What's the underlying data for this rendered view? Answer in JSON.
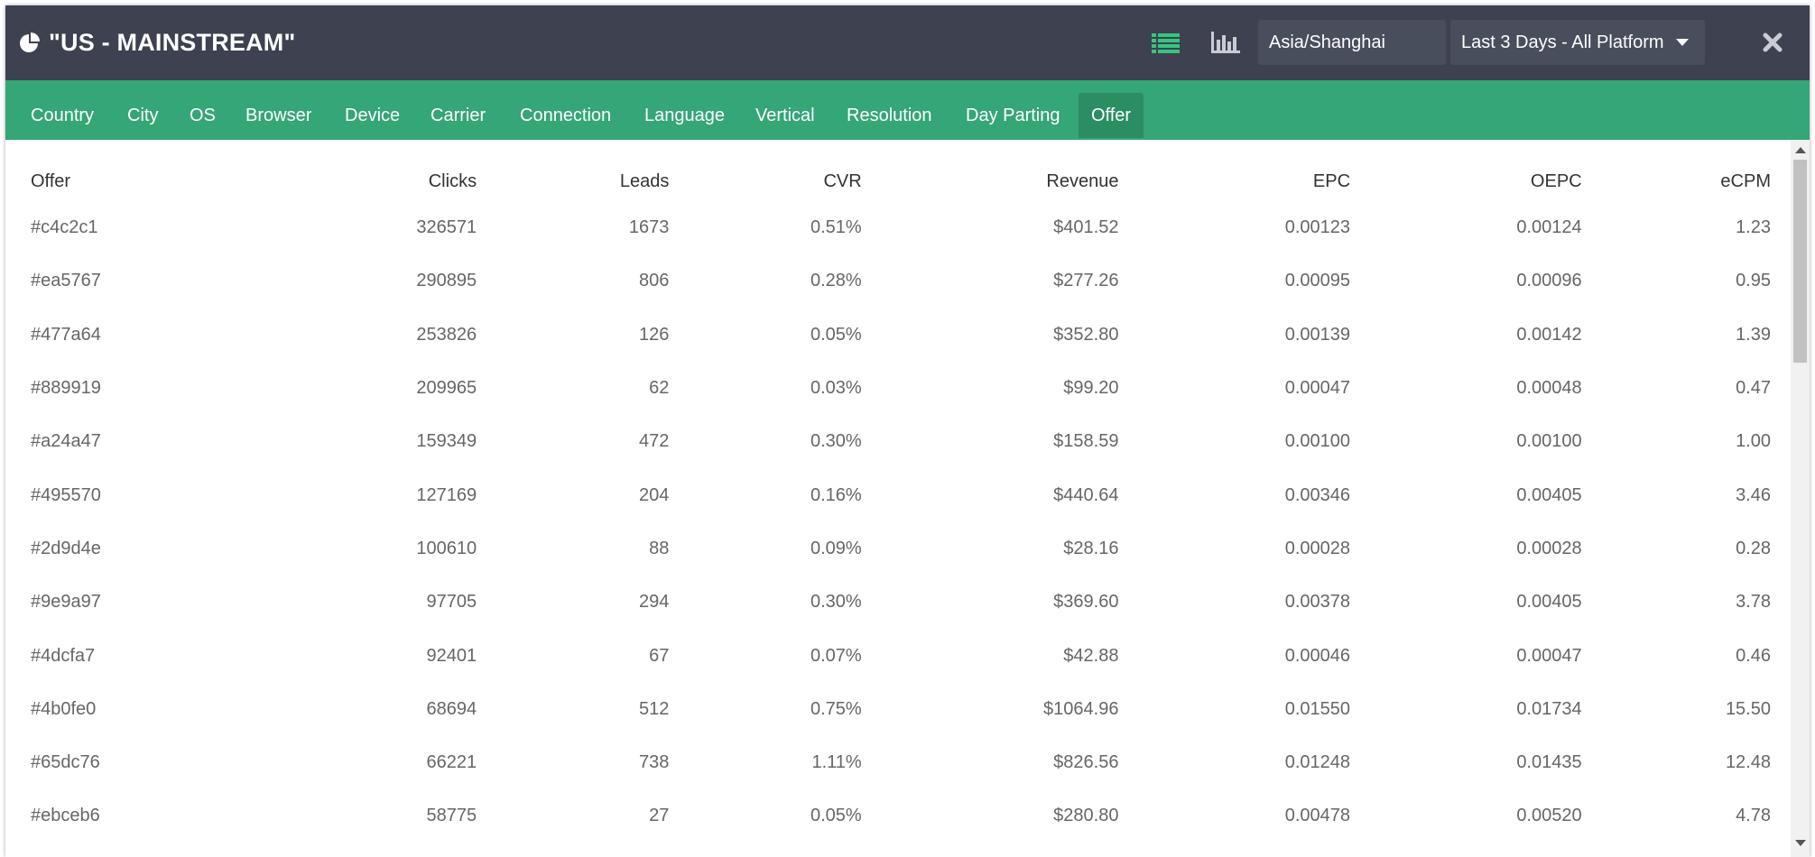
{
  "header": {
    "title": "\"US - MAINSTREAM\"",
    "title_icon": "pie-chart-icon",
    "table_view_icon": "list-icon",
    "chart_view_icon": "bar-chart-icon",
    "timezone_value": "Asia/Shanghai",
    "range_value": "Last 3 Days - All Platform",
    "close_icon": "close-icon"
  },
  "colors": {
    "header_bg": "#3d4150",
    "tab_bg": "#35a676",
    "tab_active_bg": "#2b8e62",
    "active_view_icon": "#35c77f"
  },
  "tabs": [
    {
      "label": "Country"
    },
    {
      "label": "City"
    },
    {
      "label": "OS"
    },
    {
      "label": "Browser"
    },
    {
      "label": "Device"
    },
    {
      "label": "Carrier"
    },
    {
      "label": "Connection"
    },
    {
      "label": "Language"
    },
    {
      "label": "Vertical"
    },
    {
      "label": "Resolution"
    },
    {
      "label": "Day Parting"
    },
    {
      "label": "Offer",
      "active": true
    }
  ],
  "table": {
    "columns": [
      "Offer",
      "Clicks",
      "Leads",
      "CVR",
      "Revenue",
      "EPC",
      "OEPC",
      "eCPM"
    ],
    "rows": [
      [
        "#c4c2c1",
        "326571",
        "1673",
        "0.51%",
        "$401.52",
        "0.00123",
        "0.00124",
        "1.23"
      ],
      [
        "#ea5767",
        "290895",
        "806",
        "0.28%",
        "$277.26",
        "0.00095",
        "0.00096",
        "0.95"
      ],
      [
        "#477a64",
        "253826",
        "126",
        "0.05%",
        "$352.80",
        "0.00139",
        "0.00142",
        "1.39"
      ],
      [
        "#889919",
        "209965",
        "62",
        "0.03%",
        "$99.20",
        "0.00047",
        "0.00048",
        "0.47"
      ],
      [
        "#a24a47",
        "159349",
        "472",
        "0.30%",
        "$158.59",
        "0.00100",
        "0.00100",
        "1.00"
      ],
      [
        "#495570",
        "127169",
        "204",
        "0.16%",
        "$440.64",
        "0.00346",
        "0.00405",
        "3.46"
      ],
      [
        "#2d9d4e",
        "100610",
        "88",
        "0.09%",
        "$28.16",
        "0.00028",
        "0.00028",
        "0.28"
      ],
      [
        "#9e9a97",
        "97705",
        "294",
        "0.30%",
        "$369.60",
        "0.00378",
        "0.00405",
        "3.78"
      ],
      [
        "#4dcfa7",
        "92401",
        "67",
        "0.07%",
        "$42.88",
        "0.00046",
        "0.00047",
        "0.46"
      ],
      [
        "#4b0fe0",
        "68694",
        "512",
        "0.75%",
        "$1064.96",
        "0.01550",
        "0.01734",
        "15.50"
      ],
      [
        "#65dc76",
        "66221",
        "738",
        "1.11%",
        "$826.56",
        "0.01248",
        "0.01435",
        "12.48"
      ],
      [
        "#ebceb6",
        "58775",
        "27",
        "0.05%",
        "$280.80",
        "0.00478",
        "0.00520",
        "4.78"
      ]
    ]
  }
}
